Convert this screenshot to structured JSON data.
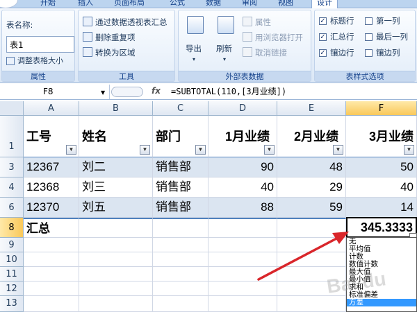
{
  "tabs": [
    {
      "label": "开始",
      "active": false
    },
    {
      "label": "插入",
      "active": false
    },
    {
      "label": "页面布局",
      "active": false
    },
    {
      "label": "公式",
      "active": false
    },
    {
      "label": "数据",
      "active": false
    },
    {
      "label": "审阅",
      "active": false
    },
    {
      "label": "视图",
      "active": false
    },
    {
      "label": "设计",
      "active": true
    }
  ],
  "ribbon": {
    "properties": {
      "title": "属性",
      "table_name_label": "表名称:",
      "table_name_value": "表1",
      "resize_label": "调整表格大小"
    },
    "tools": {
      "title": "工具",
      "pivot_summary": "通过数据透视表汇总",
      "remove_duplicates": "删除重复项",
      "convert_to_range": "转换为区域"
    },
    "external": {
      "title": "外部表数据",
      "export": "导出",
      "refresh": "刷新",
      "properties": "属性",
      "open_in_browser": "用浏览器打开",
      "unlink": "取消链接"
    },
    "style_options": {
      "title": "表样式选项",
      "header_row": {
        "label": "标题行",
        "checked": true
      },
      "total_row": {
        "label": "汇总行",
        "checked": true
      },
      "banded_rows": {
        "label": "镶边行",
        "checked": true
      },
      "first_column": {
        "label": "第一列",
        "checked": false
      },
      "last_column": {
        "label": "最后一列",
        "checked": false
      },
      "banded_columns": {
        "label": "镶边列",
        "checked": false
      }
    }
  },
  "formula_bar": {
    "name_box": "F8",
    "fx": "fx",
    "formula": "=SUBTOTAL(110,[3月业绩])"
  },
  "sheet": {
    "columns": [
      "A",
      "B",
      "C",
      "D",
      "E",
      "F"
    ],
    "header_row_num": "1",
    "headers": [
      "工号",
      "姓名",
      "部门",
      "1月业绩",
      "2月业绩",
      "3月业绩"
    ],
    "rows": [
      {
        "num": "3",
        "cells": [
          "12367",
          "刘二",
          "销售部",
          "90",
          "48",
          "50"
        ]
      },
      {
        "num": "4",
        "cells": [
          "12368",
          "刘三",
          "销售部",
          "40",
          "29",
          "40"
        ]
      },
      {
        "num": "6",
        "cells": [
          "12370",
          "刘五",
          "销售部",
          "88",
          "59",
          "14"
        ]
      }
    ],
    "total_row": {
      "num": "8",
      "label": "汇总",
      "value": "345.3333"
    },
    "empty_rows": [
      "9",
      "10",
      "11",
      "12",
      "13"
    ]
  },
  "dropdown_options": [
    "无",
    "平均值",
    "计数",
    "数值计数",
    "最大值",
    "最小值",
    "求和",
    "标准偏差",
    "方差"
  ],
  "highlighted_option_index": 8,
  "watermark": "Bai du",
  "colors": {
    "accent": "#4f81bd",
    "band": "#dbe5f1",
    "arrow": "#d9262b",
    "highlight": "#3399ff"
  }
}
